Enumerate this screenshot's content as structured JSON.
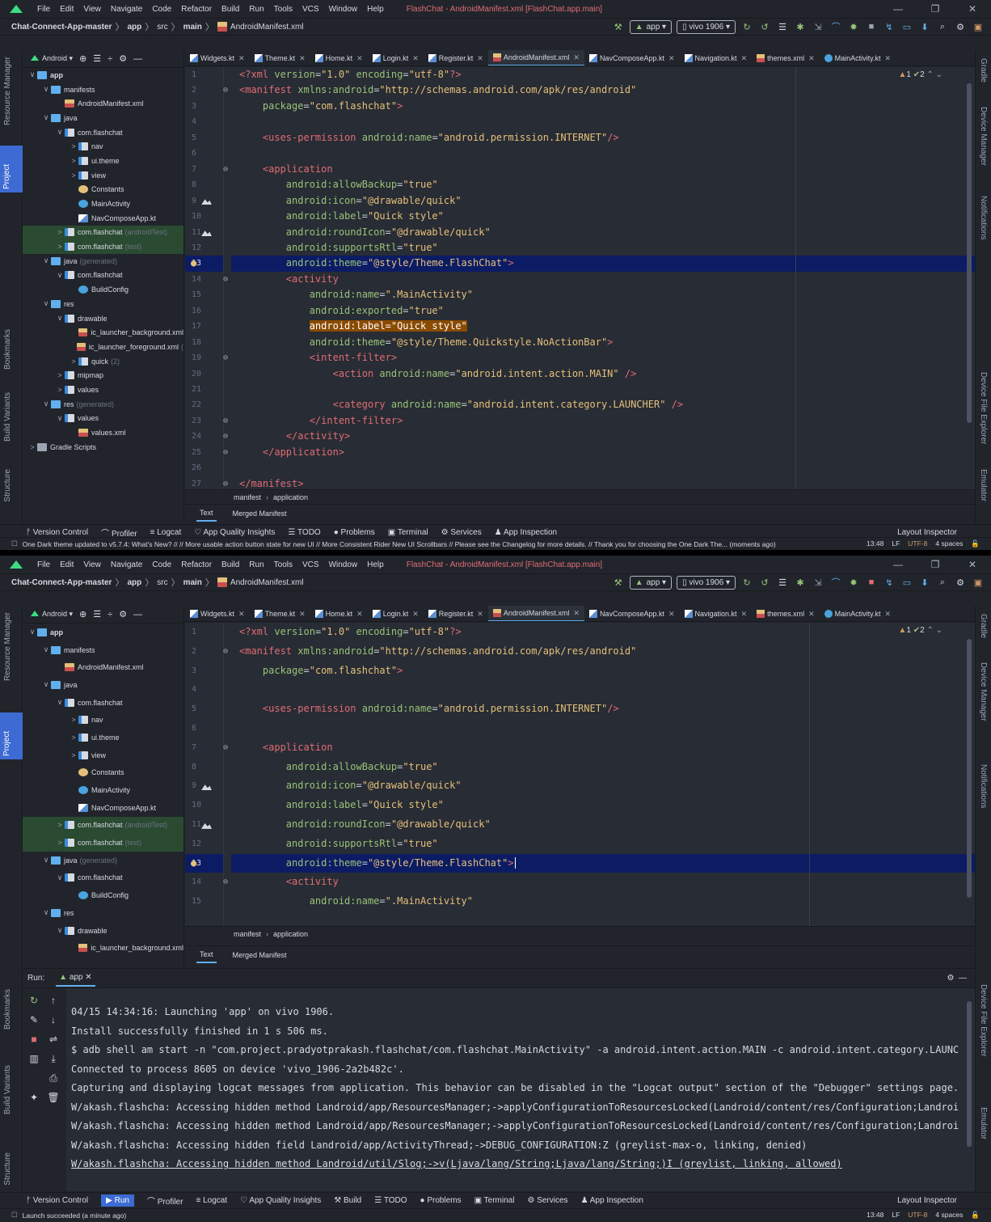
{
  "menu": [
    "File",
    "Edit",
    "View",
    "Navigate",
    "Code",
    "Refactor",
    "Build",
    "Run",
    "Tools",
    "VCS",
    "Window",
    "Help"
  ],
  "window_title": "FlashChat - AndroidManifest.xml [FlashChat.app.main]",
  "breadcrumb": {
    "project": "Chat-Connect-App-master",
    "module": "app",
    "src": "src",
    "main": "main",
    "file": "AndroidManifest.xml"
  },
  "run_config": "app",
  "device": "vivo 1906",
  "left_tools": [
    "Resource Manager",
    "Project",
    "Bookmarks",
    "Build Variants",
    "Structure"
  ],
  "right_tools": [
    "Gradle",
    "Device Manager",
    "Notifications",
    "Device File Explorer",
    "Emulator"
  ],
  "project_view": "Android",
  "tree": [
    {
      "indent": 0,
      "label": "app",
      "icon": "foldb",
      "arrow": "∨",
      "bold": true
    },
    {
      "indent": 1,
      "label": "manifests",
      "icon": "foldb",
      "arrow": "∨"
    },
    {
      "indent": 2,
      "label": "AndroidManifest.xml",
      "icon": "xml",
      "arrow": ""
    },
    {
      "indent": 1,
      "label": "java",
      "icon": "foldb",
      "arrow": "∨"
    },
    {
      "indent": 2,
      "label": "com.flashchat",
      "icon": "fold",
      "arrow": "∨"
    },
    {
      "indent": 3,
      "label": "nav",
      "icon": "fold",
      "arrow": ">"
    },
    {
      "indent": 3,
      "label": "ui.theme",
      "icon": "fold",
      "arrow": ">"
    },
    {
      "indent": 3,
      "label": "view",
      "icon": "fold",
      "arrow": ">"
    },
    {
      "indent": 3,
      "label": "Constants",
      "icon": "klass",
      "arrow": ""
    },
    {
      "indent": 3,
      "label": "MainActivity",
      "icon": "act",
      "arrow": ""
    },
    {
      "indent": 3,
      "label": "NavComposeApp.kt",
      "icon": "kt",
      "arrow": ""
    },
    {
      "indent": 2,
      "label": "com.flashchat",
      "icon": "fold",
      "arrow": ">",
      "dim": "(androidTest)",
      "hl": true
    },
    {
      "indent": 2,
      "label": "com.flashchat",
      "icon": "fold",
      "arrow": ">",
      "dim": "(test)",
      "hl": true
    },
    {
      "indent": 1,
      "label": "java",
      "icon": "foldb",
      "arrow": "∨",
      "dim": "(generated)"
    },
    {
      "indent": 2,
      "label": "com.flashchat",
      "icon": "fold",
      "arrow": "∨"
    },
    {
      "indent": 3,
      "label": "BuildConfig",
      "icon": "act",
      "arrow": ""
    },
    {
      "indent": 1,
      "label": "res",
      "icon": "foldb",
      "arrow": "∨"
    },
    {
      "indent": 2,
      "label": "drawable",
      "icon": "fold",
      "arrow": "∨"
    },
    {
      "indent": 3,
      "label": "ic_launcher_background.xml",
      "icon": "xml",
      "arrow": ""
    },
    {
      "indent": 3,
      "label": "ic_launcher_foreground.xml",
      "icon": "xml",
      "arrow": "",
      "dim": "("
    },
    {
      "indent": 3,
      "label": "quick",
      "icon": "fold",
      "arrow": ">",
      "dim": "(2)"
    },
    {
      "indent": 2,
      "label": "mipmap",
      "icon": "fold",
      "arrow": ">"
    },
    {
      "indent": 2,
      "label": "values",
      "icon": "fold",
      "arrow": ">"
    },
    {
      "indent": 1,
      "label": "res",
      "icon": "foldb",
      "arrow": "∨",
      "dim": "(generated)"
    },
    {
      "indent": 2,
      "label": "values",
      "icon": "fold",
      "arrow": "∨"
    },
    {
      "indent": 3,
      "label": "values.xml",
      "icon": "xml",
      "arrow": ""
    },
    {
      "indent": 0,
      "label": "Gradle Scripts",
      "icon": "gradle",
      "arrow": ">"
    }
  ],
  "tabs": [
    "Widgets.kt",
    "Theme.kt",
    "Home.kt",
    "Login.kt",
    "Register.kt",
    "AndroidManifest.xml",
    "NavComposeApp.kt",
    "Navigation.kt",
    "themes.xml",
    "MainActivity.kt"
  ],
  "active_tab": "AndroidManifest.xml",
  "code": [
    "<?xml version=\"1.0\" encoding=\"utf-8\"?>",
    "<manifest xmlns:android=\"http://schemas.android.com/apk/res/android\"",
    "    package=\"com.flashchat\">",
    "",
    "    <uses-permission android:name=\"android.permission.INTERNET\"/>",
    "",
    "    <application",
    "        android:allowBackup=\"true\"",
    "        android:icon=\"@drawable/quick\"",
    "        android:label=\"Quick style\"",
    "        android:roundIcon=\"@drawable/quick\"",
    "        android:supportsRtl=\"true\"",
    "        android:theme=\"@style/Theme.FlashChat\">",
    "        <activity",
    "            android:name=\".MainActivity\"",
    "            android:exported=\"true\"",
    "            android:label=\"Quick style\"",
    "            android:theme=\"@style/Theme.Quickstyle.NoActionBar\">",
    "            <intent-filter>",
    "                <action android:name=\"android.intent.action.MAIN\" />",
    "",
    "                <category android:name=\"android.intent.category.LAUNCHER\" />",
    "            </intent-filter>",
    "        </activity>",
    "    </application>",
    "",
    "</manifest>"
  ],
  "inspections": {
    "warnings": "1",
    "checks": "2"
  },
  "editor_breadcrumb": [
    "manifest",
    "application"
  ],
  "manifest_tabs": [
    "Text",
    "Merged Manifest"
  ],
  "bottom_tools_1": [
    "Version Control",
    "Profiler",
    "Logcat",
    "App Quality Insights",
    "TODO",
    "Problems",
    "Terminal",
    "Services",
    "App Inspection"
  ],
  "bottom_tools_2": [
    "Version Control",
    "Run",
    "Profiler",
    "Logcat",
    "App Quality Insights",
    "Build",
    "TODO",
    "Problems",
    "Terminal",
    "Services",
    "App Inspection"
  ],
  "layout_inspector": "Layout Inspector",
  "status1": "One Dark theme updated to v5.7.4: What's New? //   // More usable action button state for new UI   // More Consistent Rider New UI Scrollbars // Please see the Changelog for more details. // Thank you for choosing the One Dark The... (moments ago)",
  "status2": "Launch succeeded (a minute ago)",
  "status_right": {
    "time": "13:48",
    "lf": "LF",
    "enc": "UTF-8",
    "indent": "4 spaces"
  },
  "run": {
    "label": "Run:",
    "tab": "app",
    "lines": [
      "04/15 14:34:16: Launching 'app' on vivo 1906.",
      "Install successfully finished in 1 s 506 ms.",
      "$ adb shell am start -n \"com.project.pradyotprakash.flashchat/com.flashchat.MainActivity\" -a android.intent.action.MAIN -c android.intent.category.LAUNCHER",
      "Connected to process 8605 on device 'vivo_1906-2a2b482c'.",
      "Capturing and displaying logcat messages from application. This behavior can be disabled in the \"Logcat output\" section of the \"Debugger\" settings page.",
      "W/akash.flashcha: Accessing hidden method Landroid/app/ResourcesManager;->applyConfigurationToResourcesLocked(Landroid/content/res/Configuration;Landroid/con",
      "W/akash.flashcha: Accessing hidden method Landroid/app/ResourcesManager;->applyConfigurationToResourcesLocked(Landroid/content/res/Configuration;Landroid/con",
      "W/akash.flashcha: Accessing hidden field Landroid/app/ActivityThread;->DEBUG_CONFIGURATION:Z (greylist-max-o, linking, denied)",
      "W/akash.flashcha: Accessing hidden method Landroid/util/Slog;->v(Ljava/lang/String;Ljava/lang/String;)I (greylist, linking, allowed)"
    ]
  },
  "colors": {
    "bg": "#282c34",
    "panel": "#21252b",
    "current_line": "#0c1c64",
    "selection": "#8a4a00",
    "accent": "#61afef"
  }
}
